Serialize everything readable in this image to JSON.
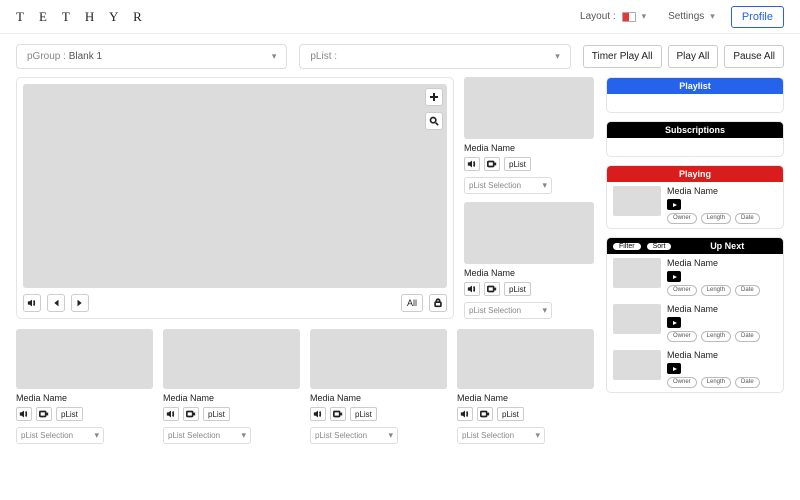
{
  "header": {
    "logo": "T E T H Y R",
    "layout_label": "Layout :",
    "settings_label": "Settings",
    "profile_label": "Profile"
  },
  "selects": {
    "pgroup_label": "pGroup :",
    "pgroup_value": "Blank 1",
    "plist_label": "pList :",
    "plist_value": ""
  },
  "topButtons": {
    "timer_play_all": "Timer Play All",
    "play_all": "Play All",
    "pause_all": "Pause All"
  },
  "hero": {
    "all_label": "All"
  },
  "card_defaults": {
    "media_name": "Media Name",
    "plist_btn": "pList",
    "plist_selection": "pList Selection"
  },
  "side_cards": [
    {
      "name": "Media Name"
    },
    {
      "name": "Media Name"
    }
  ],
  "bottom_cards": [
    {
      "name": "Media Name"
    },
    {
      "name": "Media Name"
    },
    {
      "name": "Media Name"
    },
    {
      "name": "Media Name"
    }
  ],
  "panels": {
    "playlist": "Playlist",
    "subscriptions": "Subscriptions",
    "playing": "Playing",
    "upnext": "Up Next",
    "filter": "Filter",
    "sort": "Sort"
  },
  "playing_item": {
    "name": "Media Name",
    "pills": [
      "Owner",
      "Length",
      "Date"
    ]
  },
  "upnext_items": [
    {
      "name": "Media Name",
      "pills": [
        "Owner",
        "Length",
        "Date"
      ]
    },
    {
      "name": "Media Name",
      "pills": [
        "Owner",
        "Length",
        "Date"
      ]
    },
    {
      "name": "Media Name",
      "pills": [
        "Owner",
        "Length",
        "Date"
      ]
    }
  ]
}
